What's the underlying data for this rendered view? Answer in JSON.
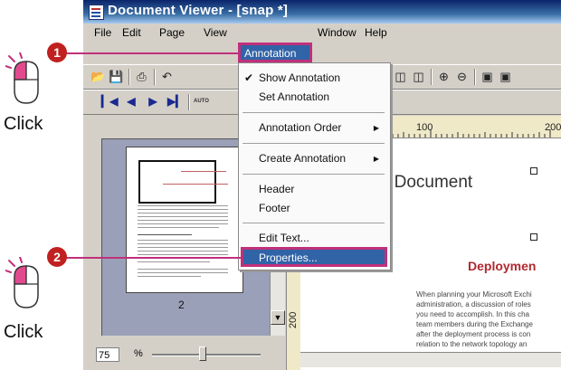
{
  "window": {
    "title": "Document Viewer - [snap *]"
  },
  "menubar": [
    "File",
    "Edit",
    "Page",
    "View",
    "Annotation",
    "Window",
    "Help"
  ],
  "annotation_menu": {
    "show_annotation": "Show Annotation",
    "set_annotation": "Set Annotation",
    "annotation_order": "Annotation Order",
    "create_annotation": "Create Annotation",
    "header": "Header",
    "footer": "Footer",
    "edit_text": "Edit Text...",
    "properties": "Properties..."
  },
  "toolbar": {
    "autofit_label": "AUTO"
  },
  "thumbnail": {
    "page_number": "2"
  },
  "zoom": {
    "value": "75",
    "unit": "%"
  },
  "ruler": {
    "h_100": "100",
    "h_200": "200",
    "v_200": "200"
  },
  "document": {
    "heading": "r Document",
    "subheading": "Deploymen",
    "body_lines": [
      "When planning your Microsoft Exchi",
      "administration, a discussion of roles",
      "you need to accomplish. In this cha",
      "team members during the Exchange",
      "after the deployment process is con",
      "relation to the network topology an"
    ]
  },
  "callouts": {
    "step1": "1",
    "step2": "2",
    "click1": "Click",
    "click2": "Click"
  },
  "colors": {
    "highlight": "#c0307a",
    "selection": "#3163a7",
    "badge": "#c02020"
  }
}
